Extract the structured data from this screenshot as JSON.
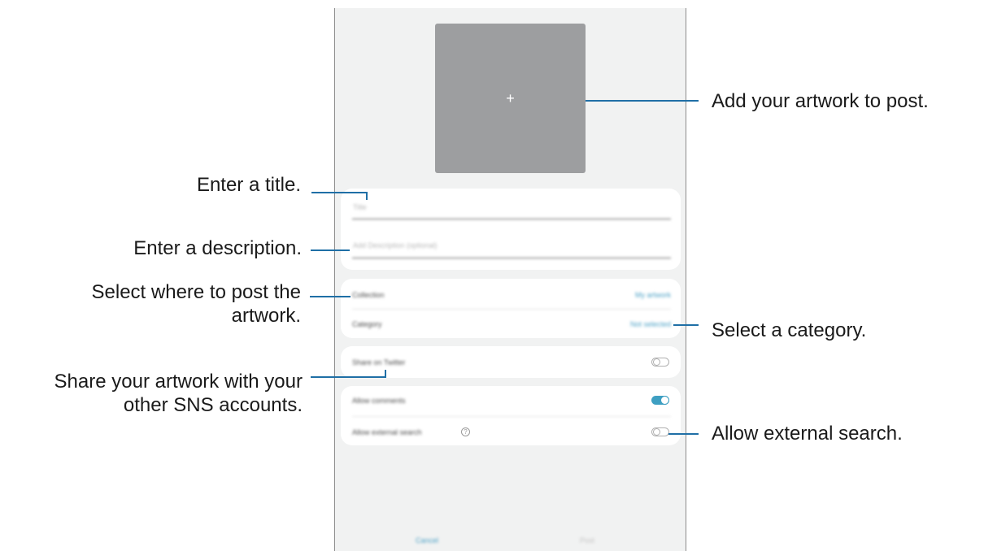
{
  "screen": {
    "add_button": "+",
    "title_placeholder": "Title",
    "description_placeholder": "Add Description (optional)",
    "rows": [
      {
        "label": "Collection",
        "value": "My artwork"
      },
      {
        "label": "Category",
        "value": "Not selected"
      }
    ],
    "share_label": "Share on Twitter",
    "comments_label": "Allow comments",
    "comments_on": true,
    "search_label": "Allow external search",
    "bottom": {
      "cancel": "Cancel",
      "post": "Post"
    }
  },
  "callouts": {
    "add_artwork": "Add your artwork to post.",
    "title": "Enter a title.",
    "description": "Enter a description.",
    "where_line1": "Select where to post the",
    "where_line2": "artwork.",
    "category": "Select a category.",
    "share_line1": "Share your artwork with your",
    "share_line2": "other SNS accounts.",
    "external_search": "Allow external search."
  },
  "colors": {
    "leader_line": "#1f6fa6",
    "accent": "#3e9fc2",
    "screen_bg": "#f1f2f2",
    "artwork_bg": "#9d9ea0"
  }
}
